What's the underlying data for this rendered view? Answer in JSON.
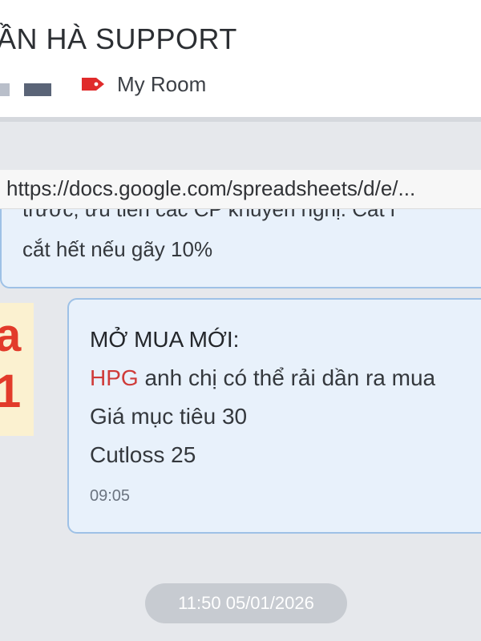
{
  "header": {
    "title": "ẦN HÀ SUPPORT",
    "room_label": "My Room"
  },
  "url_tooltip": "https://docs.google.com/spreadsheets/d/e/...",
  "messages": [
    {
      "partial_line": "trước, ưu tiên các CP khuyến nghị. Cắt l",
      "line2": "cắt hết nếu gãy 10%"
    },
    {
      "heading": "MỞ MUA MỚI:",
      "ticker": "HPG",
      "line1_rest": " anh chị có thể rải dần ra mua",
      "line2": "Giá mục tiêu 30",
      "line3": "Cutloss 25",
      "time": "09:05"
    }
  ],
  "sticker": {
    "line1": "a",
    "line2": "1"
  },
  "date_separator": "11:50 05/01/2026",
  "colors": {
    "accent_red": "#e23b2a",
    "bubble_bg": "#e8f1fb",
    "bubble_border": "#9ec1e6",
    "ticker": "#cf3b39"
  },
  "icons": [
    "tag-icon"
  ]
}
